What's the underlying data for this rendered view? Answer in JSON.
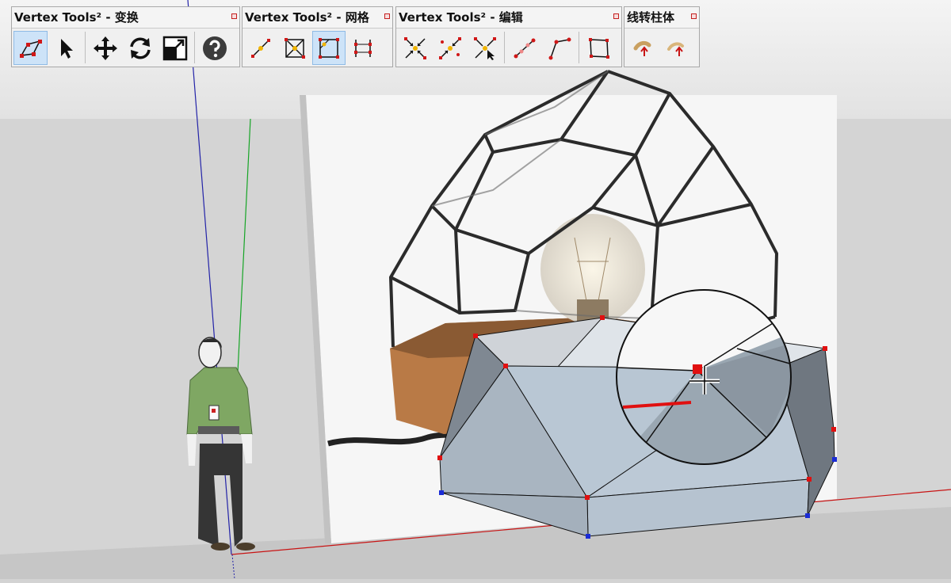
{
  "toolbars": [
    {
      "title": "Vertex Tools² - 变换",
      "buttons": [
        {
          "icon": "vertex-select-icon",
          "active": true
        },
        {
          "icon": "arrow-cursor-icon"
        },
        {
          "icon": "move-icon"
        },
        {
          "icon": "rotate-icon"
        },
        {
          "icon": "scale-icon"
        },
        {
          "icon": "help-icon"
        }
      ]
    },
    {
      "title": "Vertex Tools² - 网格",
      "buttons": [
        {
          "icon": "line-vertex-icon"
        },
        {
          "icon": "cross-grid-icon"
        },
        {
          "icon": "quad-grid-icon",
          "active": true
        },
        {
          "icon": "edge-split-icon"
        }
      ]
    },
    {
      "title": "Vertex Tools² - 编辑",
      "buttons": [
        {
          "icon": "merge-vertices-icon"
        },
        {
          "icon": "merge-center-icon"
        },
        {
          "icon": "merge-to-cursor-icon"
        },
        {
          "icon": "connect-vertices-icon"
        },
        {
          "icon": "bend-edge-icon"
        },
        {
          "icon": "square-edit-icon"
        }
      ]
    },
    {
      "title": "线转柱体",
      "buttons": [
        {
          "icon": "line-to-cylinder-icon"
        },
        {
          "icon": "line-to-cylinder-alt-icon"
        }
      ]
    }
  ],
  "colors": {
    "toolbar_bg": "#f0f0f0",
    "active_button": "#cde3f8",
    "mesh_face": "#b9c8d6",
    "vertex_selected": "#e01010",
    "vertex_unselected": "#1a2cd6",
    "axis_red": "#cc1111",
    "axis_green": "#11aa22",
    "axis_blue": "#2222aa"
  }
}
